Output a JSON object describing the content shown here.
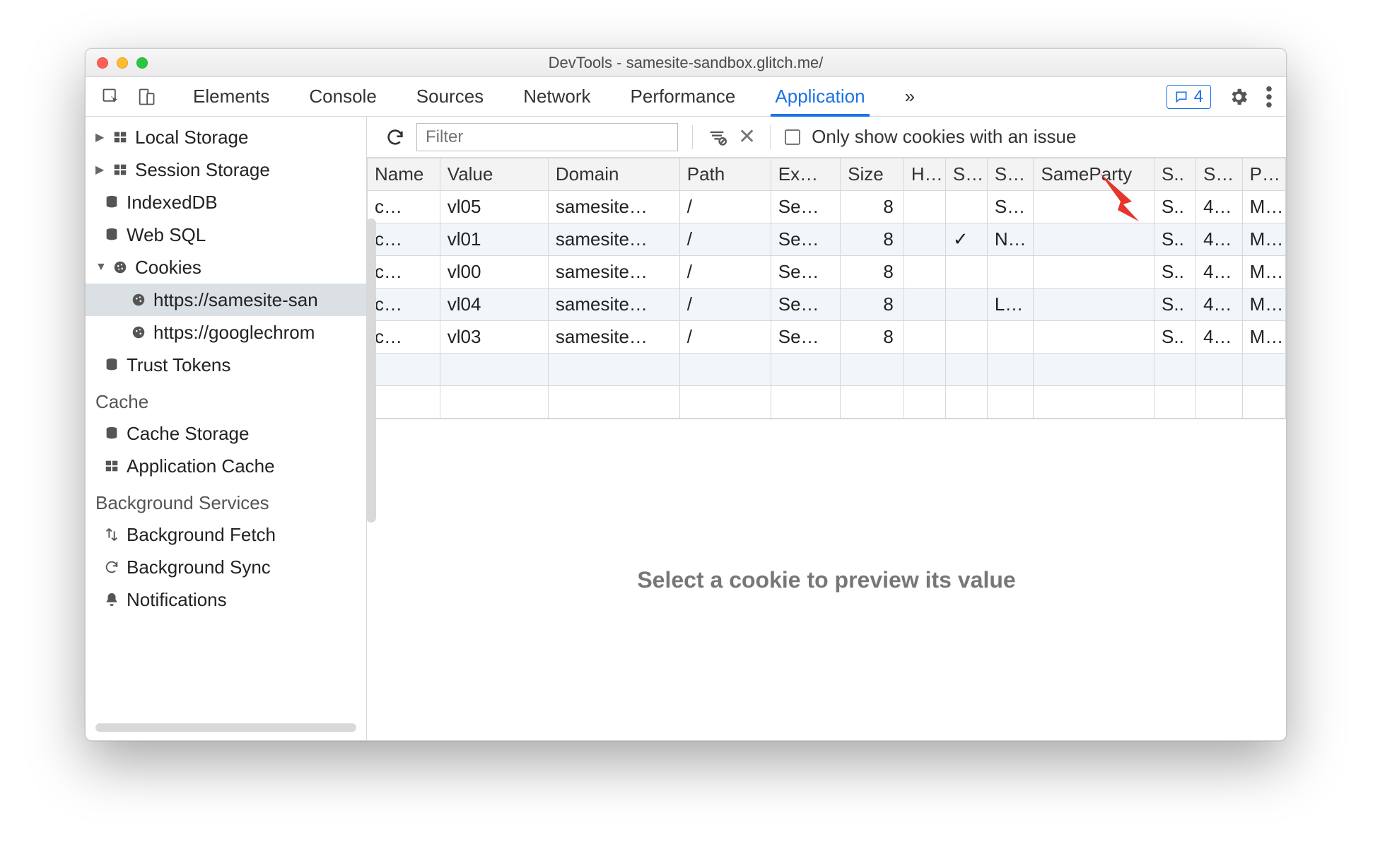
{
  "window": {
    "title": "DevTools - samesite-sandbox.glitch.me/"
  },
  "tabs": {
    "items": [
      "Elements",
      "Console",
      "Sources",
      "Network",
      "Performance",
      "Application"
    ],
    "active": "Application",
    "more_glyph": "»",
    "issues_count": "4"
  },
  "sidebar": {
    "storage": {
      "local": "Local Storage",
      "session": "Session Storage",
      "indexeddb": "IndexedDB",
      "websql": "Web SQL",
      "cookies": "Cookies",
      "cookie_origins": [
        "https://samesite-san",
        "https://googlechrom"
      ],
      "trust_tokens": "Trust Tokens"
    },
    "cache": {
      "heading": "Cache",
      "cache_storage": "Cache Storage",
      "app_cache": "Application Cache"
    },
    "bg": {
      "heading": "Background Services",
      "fetch": "Background Fetch",
      "sync": "Background Sync",
      "notifications": "Notifications"
    }
  },
  "toolbar": {
    "filter_placeholder": "Filter",
    "only_issues_label": "Only show cookies with an issue"
  },
  "table": {
    "headers": [
      "Name",
      "Value",
      "Domain",
      "Path",
      "Ex…",
      "Size",
      "H…",
      "S…",
      "S…",
      "SameParty",
      "S..",
      "S…",
      "P…"
    ],
    "rows": [
      {
        "name": "c…",
        "value": "vl05",
        "domain": "samesite…",
        "path": "/",
        "exp": "Se…",
        "size": "8",
        "h": "",
        "sec": "",
        "ss": "S…",
        "sp": "",
        "s3": "S..",
        "s4": "4…",
        "p": "M…"
      },
      {
        "name": "c…",
        "value": "vl01",
        "domain": "samesite…",
        "path": "/",
        "exp": "Se…",
        "size": "8",
        "h": "",
        "sec": "✓",
        "ss": "N…",
        "sp": "",
        "s3": "S..",
        "s4": "4…",
        "p": "M…"
      },
      {
        "name": "c…",
        "value": "vl00",
        "domain": "samesite…",
        "path": "/",
        "exp": "Se…",
        "size": "8",
        "h": "",
        "sec": "",
        "ss": "",
        "sp": "",
        "s3": "S..",
        "s4": "4…",
        "p": "M…"
      },
      {
        "name": "c…",
        "value": "vl04",
        "domain": "samesite…",
        "path": "/",
        "exp": "Se…",
        "size": "8",
        "h": "",
        "sec": "",
        "ss": "L…",
        "sp": "",
        "s3": "S..",
        "s4": "4…",
        "p": "M…"
      },
      {
        "name": "c…",
        "value": "vl03",
        "domain": "samesite…",
        "path": "/",
        "exp": "Se…",
        "size": "8",
        "h": "",
        "sec": "",
        "ss": "",
        "sp": "",
        "s3": "S..",
        "s4": "4…",
        "p": "M…"
      }
    ]
  },
  "preview": {
    "message": "Select a cookie to preview its value"
  }
}
